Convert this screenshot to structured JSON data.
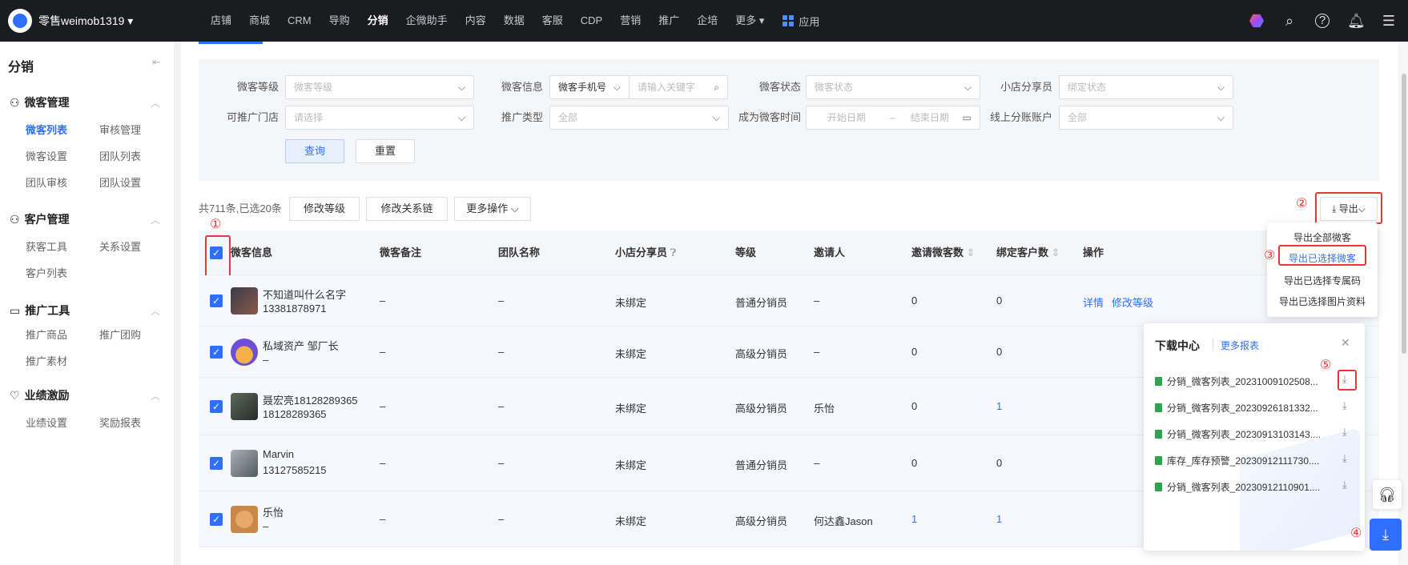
{
  "topbar": {
    "brand": "零售weimob1319 ▾",
    "nav": [
      "店铺",
      "商城",
      "CRM",
      "导购",
      "分销",
      "企微助手",
      "内容",
      "数据",
      "客服",
      "CDP",
      "营销",
      "推广",
      "企培",
      "更多 ▾"
    ],
    "active_nav": "分销",
    "app_label": "应用"
  },
  "sidebar": {
    "title": "分销",
    "groups": [
      {
        "label": "微客管理",
        "items": [
          "微客列表",
          "审核管理",
          "微客设置",
          "团队列表",
          "团队审核",
          "团队设置"
        ]
      },
      {
        "label": "客户管理",
        "items": [
          "获客工具",
          "关系设置",
          "客户列表"
        ]
      },
      {
        "label": "推广工具",
        "items": [
          "推广商品",
          "推广团购",
          "推广素材"
        ]
      },
      {
        "label": "业绩激励",
        "items": [
          "业绩设置",
          "奖励报表"
        ]
      }
    ],
    "active_item": "微客列表"
  },
  "filters": {
    "level_label": "微客等级",
    "level_placeholder": "微客等级",
    "info_label": "微客信息",
    "info_type": "微客手机号",
    "info_placeholder": "请输入关键字",
    "status_label": "微客状态",
    "status_placeholder": "微客状态",
    "sharer_label": "小店分享员",
    "sharer_placeholder": "绑定状态",
    "store_label": "可推广门店",
    "store_placeholder": "请选择",
    "promo_label": "推广类型",
    "promo_value": "全部",
    "time_label": "成为微客时间",
    "start_placeholder": "开始日期",
    "range_sep": "–",
    "end_placeholder": "结束日期",
    "account_label": "线上分账账户",
    "account_value": "全部",
    "query": "查询",
    "reset": "重置"
  },
  "toolbar": {
    "count": "共711条,已选20条",
    "edit_level": "修改等级",
    "edit_relation": "修改关系链",
    "more_ops": "更多操作 ⌵",
    "export": "导出⌵"
  },
  "export_menu": [
    "导出全部微客",
    "导出已选择微客",
    "导出已选择专属码",
    "导出已选择图片资料"
  ],
  "table": {
    "headers": [
      "微客信息",
      "微客备注",
      "团队名称",
      "小店分享员",
      "等级",
      "邀请人",
      "邀请微客数",
      "绑定客户数",
      "操作"
    ],
    "rows": [
      {
        "name": "不知道叫什么名字",
        "phone": "13381878971",
        "note": "–",
        "team": "–",
        "sharer": "未绑定",
        "level": "普通分销员",
        "inviter": "–",
        "invites": "0",
        "bound": "0"
      },
      {
        "name": "私域资产 邹厂长",
        "phone": "–",
        "note": "–",
        "team": "–",
        "sharer": "未绑定",
        "level": "高级分销员",
        "inviter": "–",
        "invites": "0",
        "bound": "0"
      },
      {
        "name": "聂宏亮18128289365",
        "phone": "18128289365",
        "note": "–",
        "team": "–",
        "sharer": "未绑定",
        "level": "高级分销员",
        "inviter": "乐怡",
        "invites": "0",
        "bound": "1"
      },
      {
        "name": "Marvin",
        "phone": "13127585215",
        "note": "–",
        "team": "–",
        "sharer": "未绑定",
        "level": "普通分销员",
        "inviter": "–",
        "invites": "0",
        "bound": "0"
      },
      {
        "name": "乐怡",
        "phone": "–",
        "note": "–",
        "team": "–",
        "sharer": "未绑定",
        "level": "高级分销员",
        "inviter": "何达鑫Jason",
        "invites": "1",
        "bound": "1"
      }
    ],
    "actions": [
      "详情",
      "修改等级"
    ]
  },
  "download_center": {
    "title": "下载中心",
    "more": "更多报表",
    "files": [
      "分销_微客列表_20231009102508...",
      "分销_微客列表_20230926181332...",
      "分销_微客列表_20230913103143....",
      "库存_库存预警_20230912111730....",
      "分销_微客列表_20230912110901...."
    ]
  },
  "annotations": [
    "①",
    "②",
    "③",
    "④",
    "⑤"
  ],
  "colors": {
    "accent": "#2f6fff",
    "annotation": "#e53935",
    "topbar": "#1b1c20"
  }
}
